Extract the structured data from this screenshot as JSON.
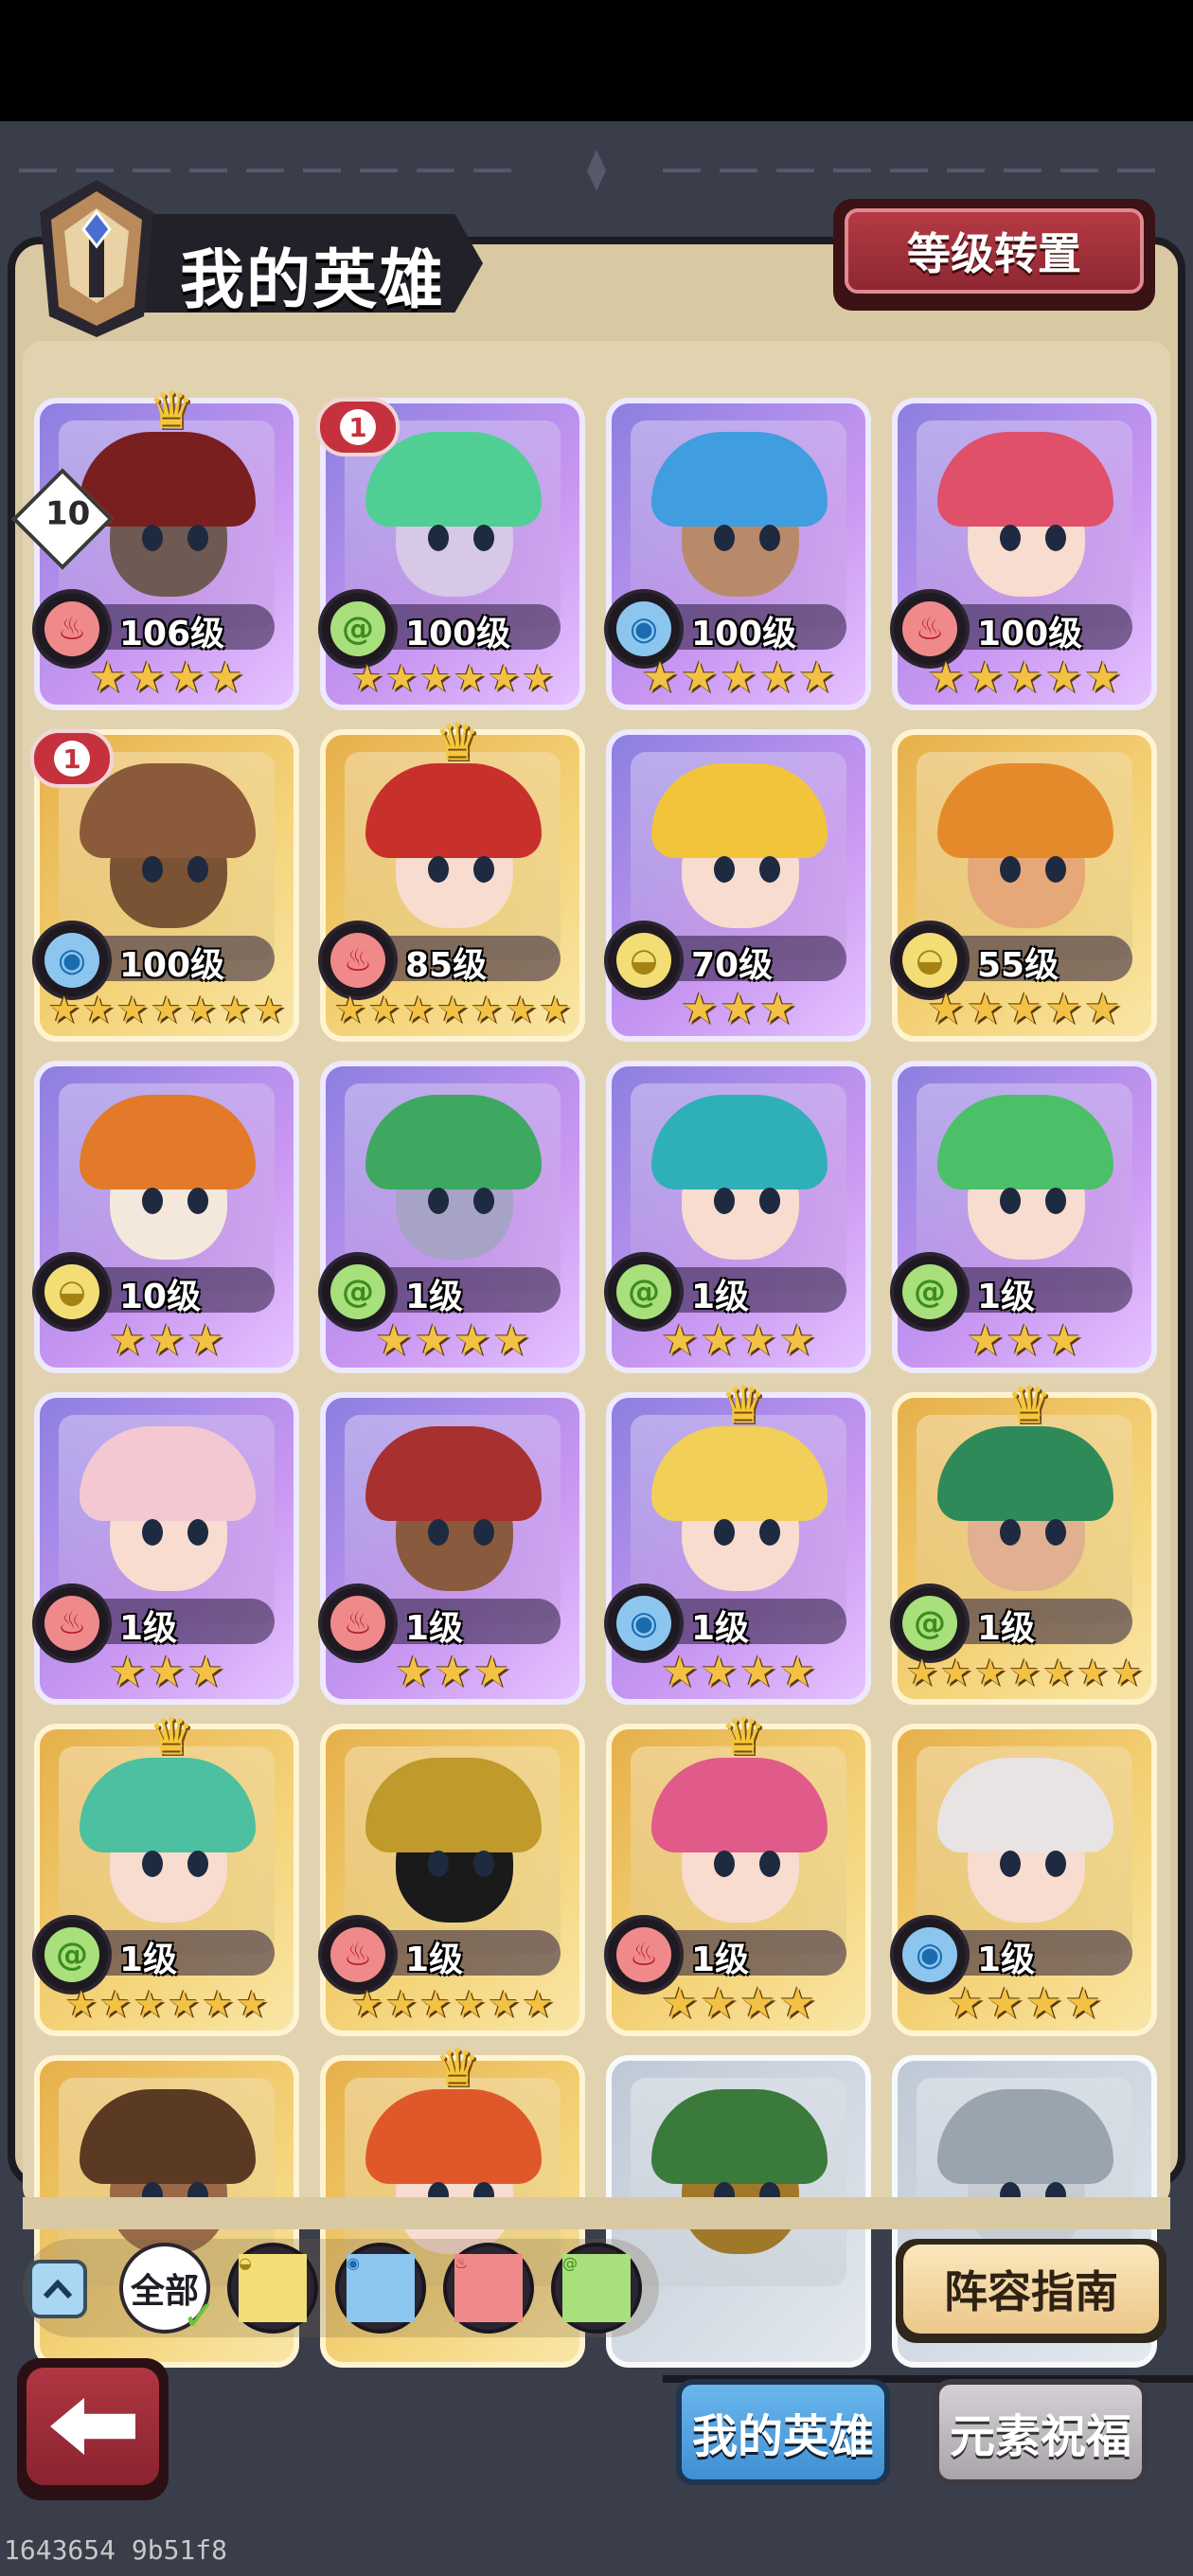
{
  "header": {
    "title": "我的英雄",
    "level_transfer_button": "等级转置"
  },
  "heroes": [
    {
      "level": "106级",
      "element": "fire",
      "stars": 4,
      "frame": "purple",
      "hair": "#7a1f1f",
      "crown": true,
      "rank_badge": "10",
      "skin": "#6e5a52"
    },
    {
      "level": "100级",
      "element": "wind",
      "stars": 6,
      "frame": "purple",
      "hair": "#4fcf94",
      "red_badge": "1",
      "skin": "#d7c8e8"
    },
    {
      "level": "100级",
      "element": "water",
      "stars": 5,
      "frame": "purple",
      "hair": "#3f9de0",
      "skin": "#b98a6a"
    },
    {
      "level": "100级",
      "element": "fire",
      "stars": 5,
      "frame": "purple",
      "hair": "#e0506a",
      "skin": "#f8dcd0"
    },
    {
      "level": "100级",
      "element": "water",
      "stars": 7,
      "frame": "gold",
      "hair": "#8a5a3a",
      "red_badge": "1",
      "skin": "#7a5234"
    },
    {
      "level": "85级",
      "element": "fire",
      "stars": 7,
      "frame": "gold",
      "hair": "#c8302c",
      "crown": true,
      "skin": "#f8dcd0"
    },
    {
      "level": "70级",
      "element": "earth",
      "stars": 3,
      "frame": "purple",
      "hair": "#f2c43a",
      "skin": "#f8dcd0"
    },
    {
      "level": "55级",
      "element": "earth",
      "stars": 5,
      "frame": "gold",
      "hair": "#e58a2a",
      "skin": "#e6a878"
    },
    {
      "level": "10级",
      "element": "earth",
      "stars": 3,
      "frame": "purple",
      "hair": "#e27a2a",
      "skin": "#f4e8dc"
    },
    {
      "level": "1级",
      "element": "wind",
      "stars": 4,
      "frame": "purple",
      "hair": "#3ea860",
      "skin": "#a7a3c6"
    },
    {
      "level": "1级",
      "element": "wind",
      "stars": 4,
      "frame": "purple",
      "hair": "#2fb0b8",
      "skin": "#f8dcd0"
    },
    {
      "level": "1级",
      "element": "wind",
      "stars": 3,
      "frame": "purple",
      "hair": "#4cc068",
      "skin": "#f8dcd0"
    },
    {
      "level": "1级",
      "element": "fire",
      "stars": 3,
      "frame": "purple",
      "hair": "#f3c8d2",
      "skin": "#f8dcd0"
    },
    {
      "level": "1级",
      "element": "fire",
      "stars": 3,
      "frame": "purple",
      "hair": "#a8302e",
      "skin": "#8a5a3e"
    },
    {
      "level": "1级",
      "element": "water",
      "stars": 4,
      "frame": "purple",
      "hair": "#f1cf58",
      "crown": true,
      "skin": "#f8dcd0"
    },
    {
      "level": "1级",
      "element": "wind",
      "stars": 7,
      "frame": "gold",
      "hair": "#2f8a5a",
      "crown": true,
      "skin": "#e0b090"
    },
    {
      "level": "1级",
      "element": "wind",
      "stars": 6,
      "frame": "gold",
      "hair": "#4cc0a0",
      "crown": true,
      "skin": "#f8dcd0"
    },
    {
      "level": "1级",
      "element": "fire",
      "stars": 6,
      "frame": "gold",
      "hair": "#c09a2a",
      "skin": "#1a1a1a"
    },
    {
      "level": "1级",
      "element": "fire",
      "stars": 4,
      "frame": "gold",
      "hair": "#e05a8a",
      "crown": true,
      "skin": "#f8dcd0"
    },
    {
      "level": "1级",
      "element": "water",
      "stars": 4,
      "frame": "gold",
      "hair": "#e8e4e4",
      "skin": "#f8dcd0"
    },
    {
      "frame": "gold",
      "hair": "#5a3a22",
      "skin": "#9a6a48"
    },
    {
      "frame": "gold",
      "hair": "#e0582a",
      "crown": true,
      "skin": "#f8dcd0"
    },
    {
      "frame": "silver",
      "hair": "#3a7a3a",
      "skin": "#a0782a"
    },
    {
      "frame": "silver",
      "hair": "#9aa4ae",
      "skin": "#c8ccd2"
    }
  ],
  "filters": {
    "all_label": "全部",
    "elements": [
      "earth",
      "water",
      "fire",
      "wind"
    ]
  },
  "lineup_guide_button": "阵容指南",
  "tabs": {
    "my_heroes": "我的英雄",
    "element_blessing": "元素祝福"
  },
  "build_id": "1643654 9b51f8"
}
